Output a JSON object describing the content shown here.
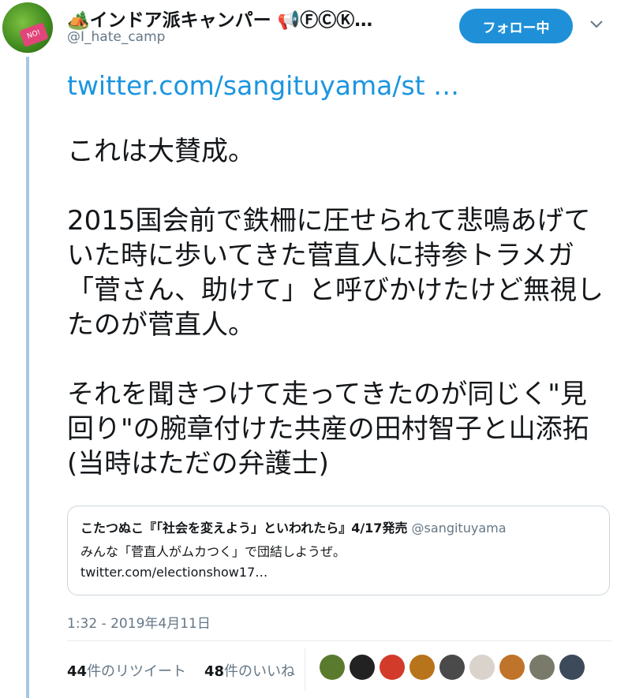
{
  "author": {
    "display_name": "🏕️インドア派キャンパー 📢ⒻⒸⓀ…",
    "handle": "@I_hate_camp",
    "avatar_sign": "NO!"
  },
  "follow_button_label": "フォロー中",
  "tweet": {
    "link": "twitter.com/sangituyama/st …",
    "text": "これは大賛成。\n\n2015国会前で鉄柵に圧せられて悲鳴あげていた時に歩いてきた菅直人に持参トラメガ「菅さん、助けて」と呼びかけたけど無視したのが菅直人。\n\nそれを聞きつけて走ってきたのが同じく\"見回り\"の腕章付けた共産の田村智子と山添拓(当時はただの弁護士)"
  },
  "quoted": {
    "name": "こたつぬこ『「社会を変えよう」といわれたら』4/17発売",
    "handle": "@sangituyama",
    "text": "みんな「菅直人がムカつく」で団結しようぜ。",
    "link": "twitter.com/electionshow17…"
  },
  "timestamp": "1:32 - 2019年4月11日",
  "stats": {
    "retweets_count": "44",
    "retweets_label": "件のリツイート",
    "likes_count": "48",
    "likes_label": "件のいいね"
  },
  "liker_avatars": [
    {
      "icon": "liker-avatar-icon",
      "color": "#5a7a2e"
    },
    {
      "icon": "liker-avatar-icon",
      "color": "#222222"
    },
    {
      "icon": "liker-avatar-icon",
      "color": "#d23a2a"
    },
    {
      "icon": "liker-avatar-icon",
      "color": "#b8741a"
    },
    {
      "icon": "liker-avatar-icon",
      "color": "#4a4a4a"
    },
    {
      "icon": "liker-avatar-icon",
      "color": "#d9d3cc"
    },
    {
      "icon": "liker-avatar-icon",
      "color": "#c0732a"
    },
    {
      "icon": "liker-avatar-icon",
      "color": "#7a7a6a"
    },
    {
      "icon": "liker-avatar-icon",
      "color": "#3c4a5a"
    }
  ]
}
